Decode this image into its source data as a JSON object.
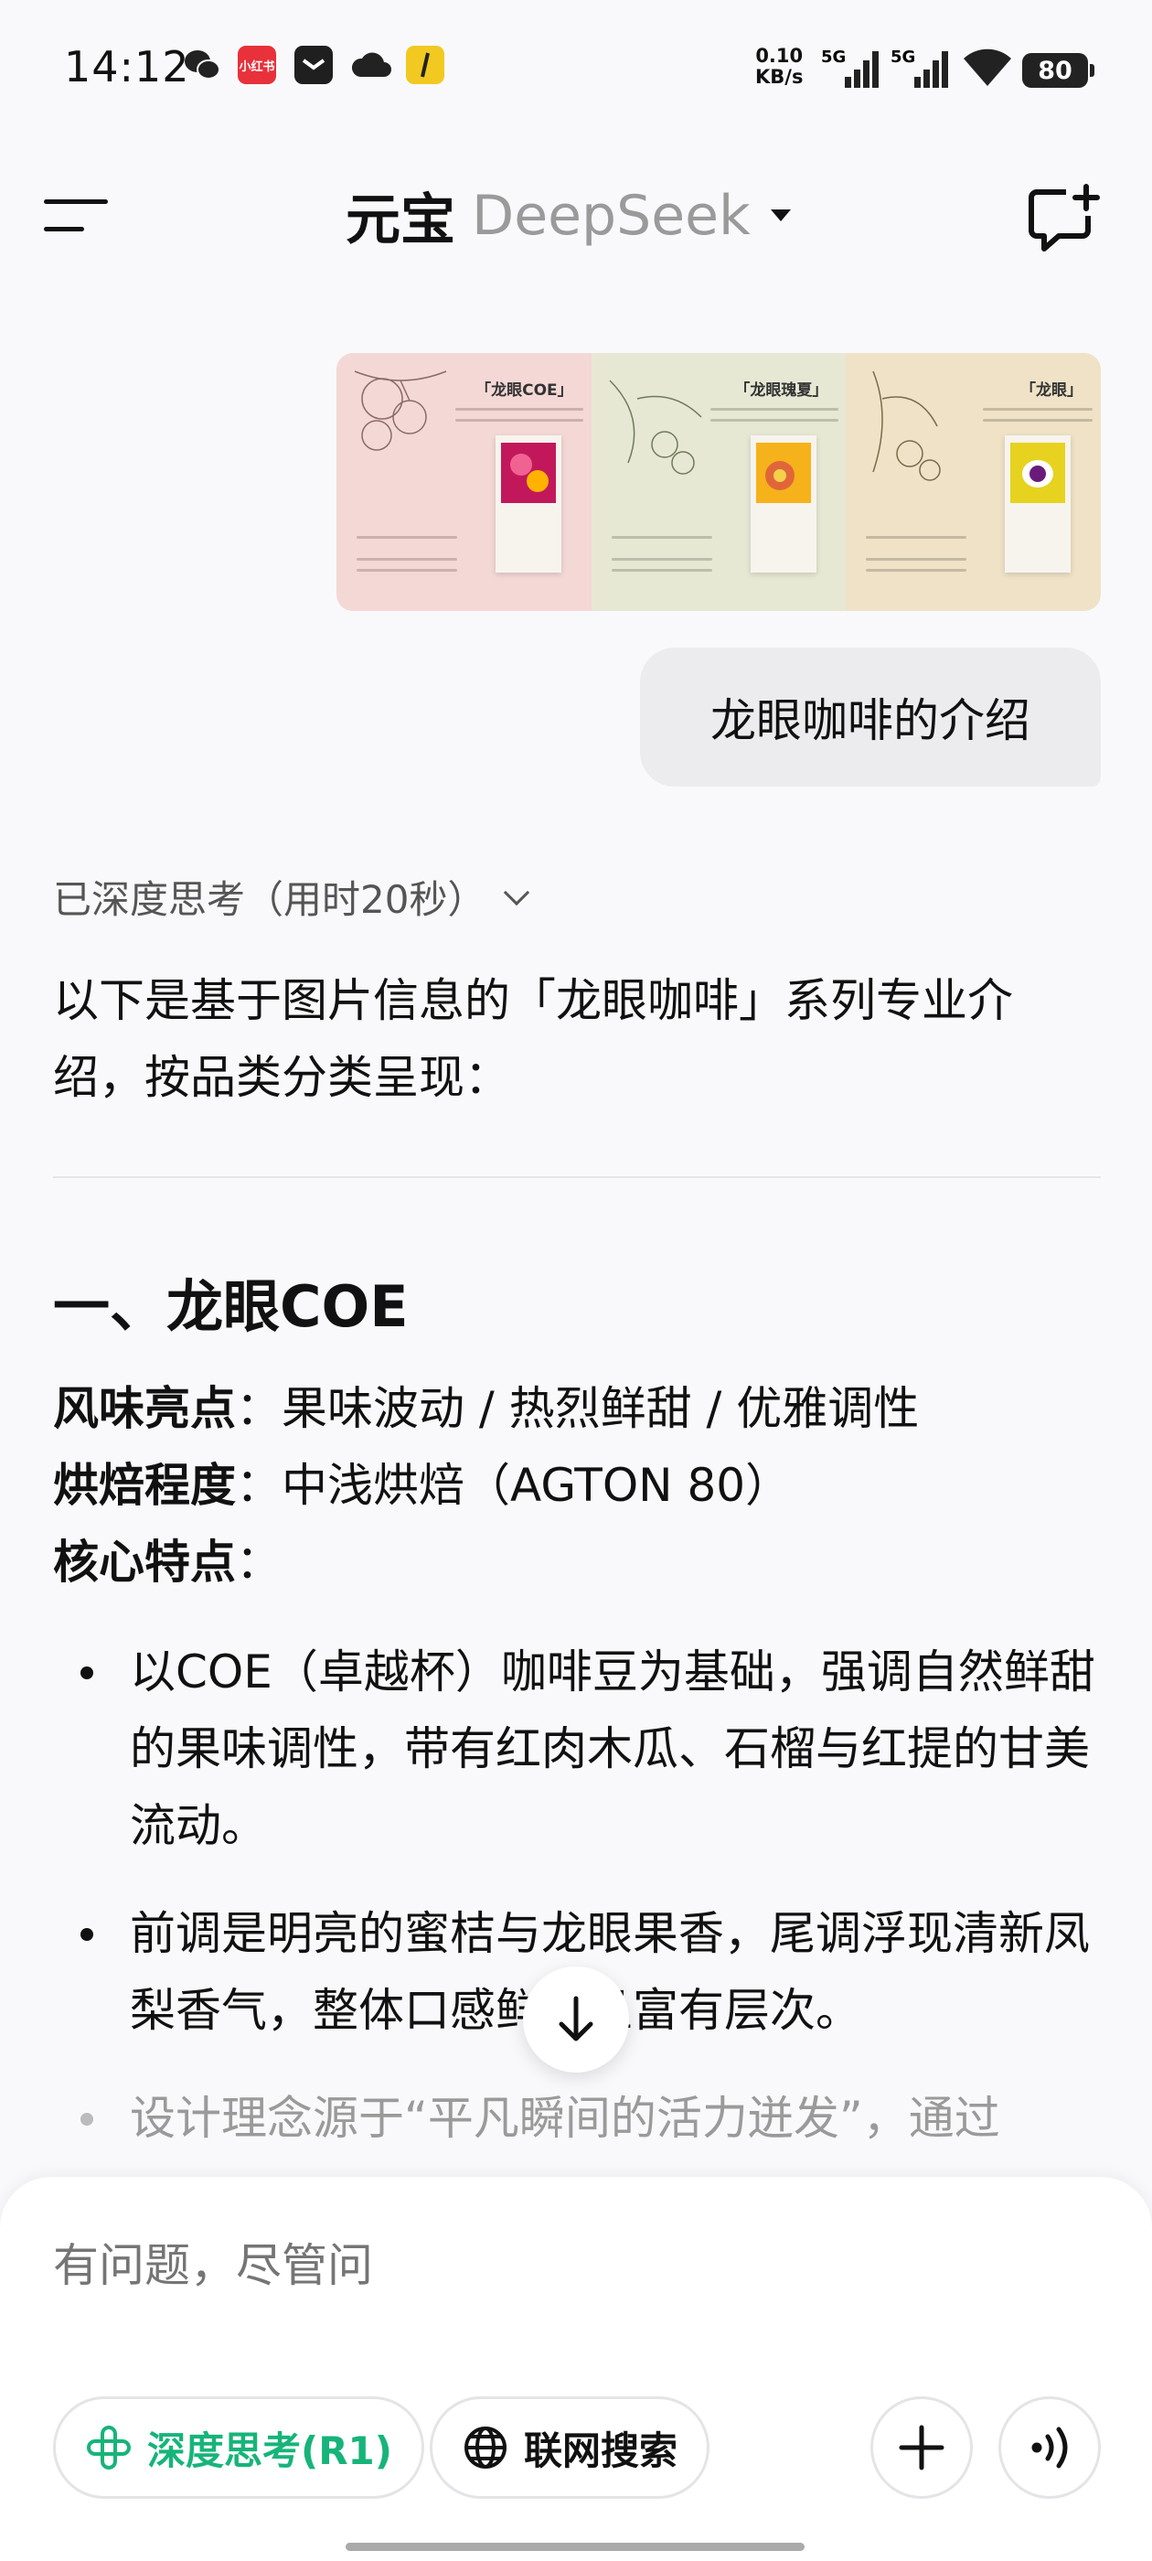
{
  "status_bar": {
    "time": "14:12",
    "net_speed_value": "0.10",
    "net_speed_unit": "KB/s",
    "sig1": "5G",
    "sig2": "5G",
    "battery": "80",
    "xhs_label": "小红书"
  },
  "header": {
    "title": "元宝",
    "model": "DeepSeek"
  },
  "attachments": {
    "cards": [
      {
        "title": "「龙眼COE」"
      },
      {
        "title": "「龙眼瑰夏」"
      },
      {
        "title": "「龙眼」"
      }
    ]
  },
  "user_message": "龙眼咖啡的介绍",
  "thought_status": "已深度思考（用时20秒）",
  "answer": {
    "intro": "以下是基于图片信息的「龙眼咖啡」系列专业介绍，按品类分类呈现：",
    "section1": {
      "heading": "一、龙眼COE",
      "flavor_label": "风味亮点",
      "flavor_value": "：果味波动 / 热烈鲜甜 / 优雅调性",
      "roast_label": "烘焙程度",
      "roast_value": "：中浅烘焙（AGTON 80）",
      "features_label": "核心特点",
      "features_value": "：",
      "bullets": [
        "以COE（卓越杯）咖啡豆为基础，强调自然鲜甜的果味调性，带有红肉木瓜、石榴与红提的甘美流动。",
        "前调是明亮的蜜桔与龙眼果香，尾调浮现清新凤梨香气，整体口感鲜活且富有层次。",
        "设计理念源于“平凡瞬间的活力迸发”，通过"
      ]
    }
  },
  "composer": {
    "placeholder": "有问题，尽管问",
    "deep_think_label": "深度思考(R1)",
    "web_search_label": "联网搜索"
  },
  "colors": {
    "accent_green": "#17b47a",
    "bubble_bg": "#ececef",
    "page_bg": "#f9f9fb"
  }
}
